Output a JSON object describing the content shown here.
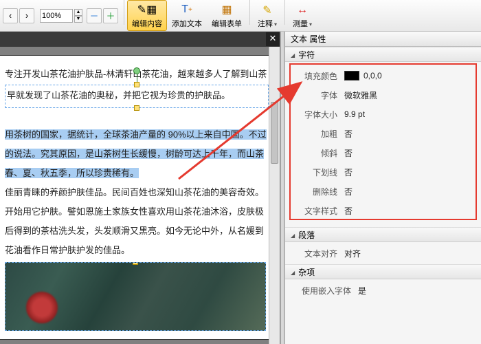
{
  "toolbar": {
    "zoom": "100%",
    "edit_content": "编辑内容",
    "add_text": "添加文本",
    "edit_form": "编辑表单",
    "annotate": "注释",
    "measure": "测量"
  },
  "doc": {
    "p1": "专注开发山茶花油护肤品-林清轩山茶花油，越来越多人了解到山茶",
    "p2a": "早就发现了山茶花油的奥秘，并把它视为珍贵的护肤品。",
    "p3": "用茶树的国家，据统计，全球茶油产量的 90%以上来自中国。不过",
    "p4": "的说法。究其原因，是山茶树生长缓慢，树龄可达上千年，而山茶",
    "p5": "春、夏、秋五季，所以珍贵稀有。",
    "p6": "佳丽青睐的养颜护肤佳品。民间百姓也深知山茶花油的美容奇效。",
    "p7": "开始用它护肤。譬如恩施土家族女性喜欢用山茶花油沐浴，皮肤极",
    "p8": "后得到的茶枯洗头发，头发顺滑又黑亮。如今无论中外，从名媛到",
    "p9": "花油看作日常护肤护发的佳品。"
  },
  "panel": {
    "title": "文本 属性",
    "section_char": "字符",
    "section_para": "段落",
    "section_misc": "杂项",
    "rows": {
      "fill_color_k": "填充颜色",
      "fill_color_v": "0,0,0",
      "font_k": "字体",
      "font_v": "微软雅黑",
      "size_k": "字体大小",
      "size_v": "9.9 pt",
      "bold_k": "加粗",
      "bold_v": "否",
      "italic_k": "倾斜",
      "italic_v": "否",
      "underline_k": "下划线",
      "underline_v": "否",
      "strike_k": "删除线",
      "strike_v": "否",
      "style_k": "文字样式",
      "style_v": "否",
      "align_k": "文本对齐",
      "align_v": "对齐",
      "embed_k": "使用嵌入字体",
      "embed_v": "是"
    }
  }
}
